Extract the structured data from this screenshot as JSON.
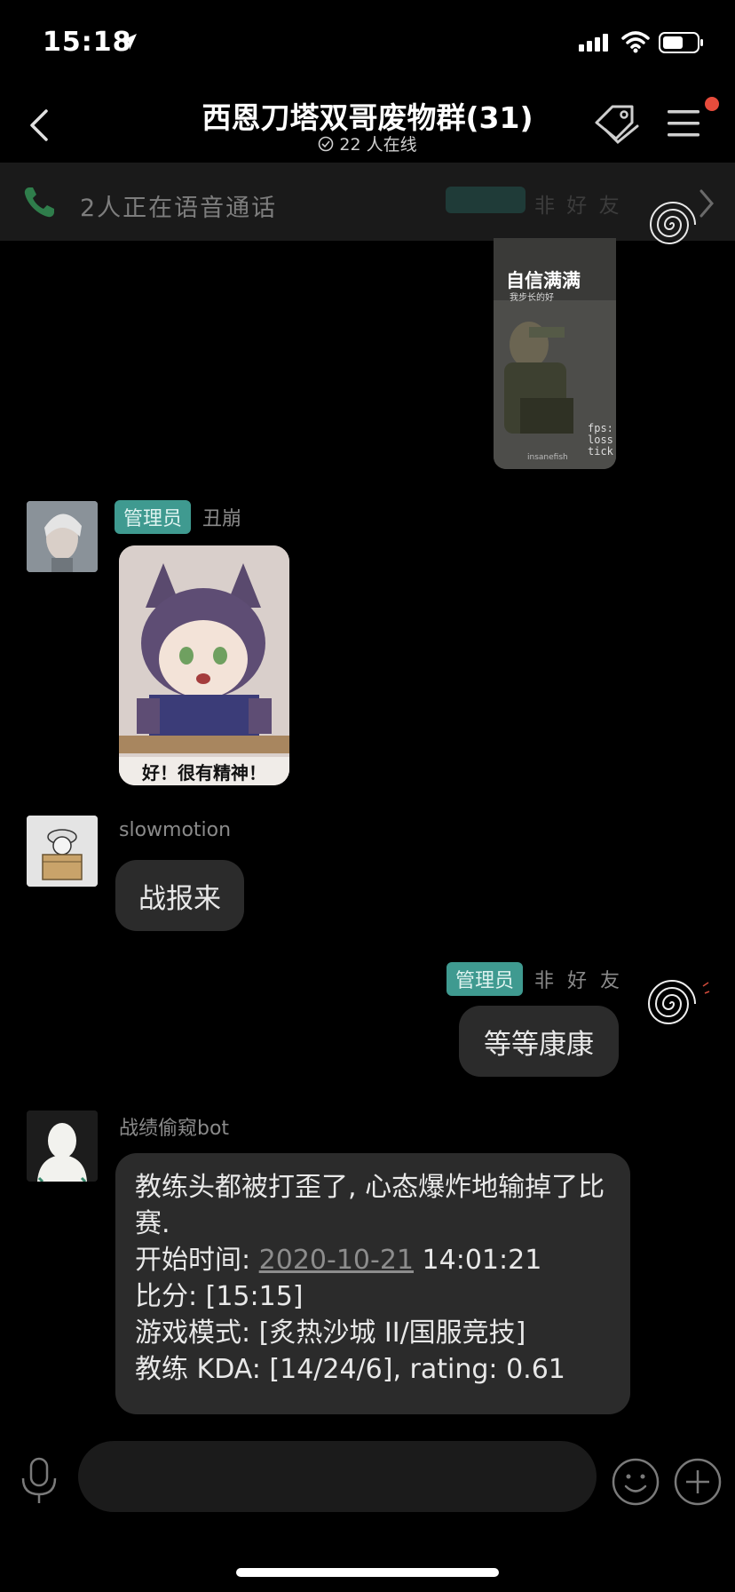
{
  "status_bar": {
    "time": "15:18"
  },
  "header": {
    "title": "西恩刀塔双哥废物群(31)",
    "online_text": "22 人在线"
  },
  "call_bar": {
    "text": "2人正在语音通话",
    "ghost_badge": "管理员",
    "ghost_name": "非 好 友"
  },
  "messages": [
    {
      "type": "image",
      "side": "right",
      "caption_top": "自信满满",
      "caption_sub": "我步长的好",
      "side_text": "fps:\nloss\ntick",
      "watermark": "insanefish"
    },
    {
      "type": "image",
      "side": "left",
      "badge": "管理员",
      "sender": "丑崩",
      "caption": "好！很有精神！"
    },
    {
      "type": "text",
      "side": "left",
      "sender": "slowmotion",
      "text": "战报来"
    },
    {
      "type": "text",
      "side": "right",
      "badge": "管理员",
      "sender": "非 好 友",
      "text": "等等康康"
    },
    {
      "type": "text",
      "side": "left",
      "sender": "战绩偷窥bot",
      "lines": {
        "line1": "教练头都被打歪了, 心态爆炸地输掉了比赛.",
        "start_label": "开始时间: ",
        "start_date": "2020-10-21",
        "start_time": " 14:01:21",
        "score": "比分: [15:15]",
        "mode": "游戏模式: [炙热沙城 II/国服竞技]",
        "kda": "教练 KDA: [14/24/6], rating: 0.61"
      }
    }
  ],
  "input_bar": {
    "placeholder": ""
  },
  "colors": {
    "accent": "#3f9a90",
    "background": "#000000",
    "bubble": "#2b2b2b",
    "notification_dot": "#e74c3c"
  }
}
